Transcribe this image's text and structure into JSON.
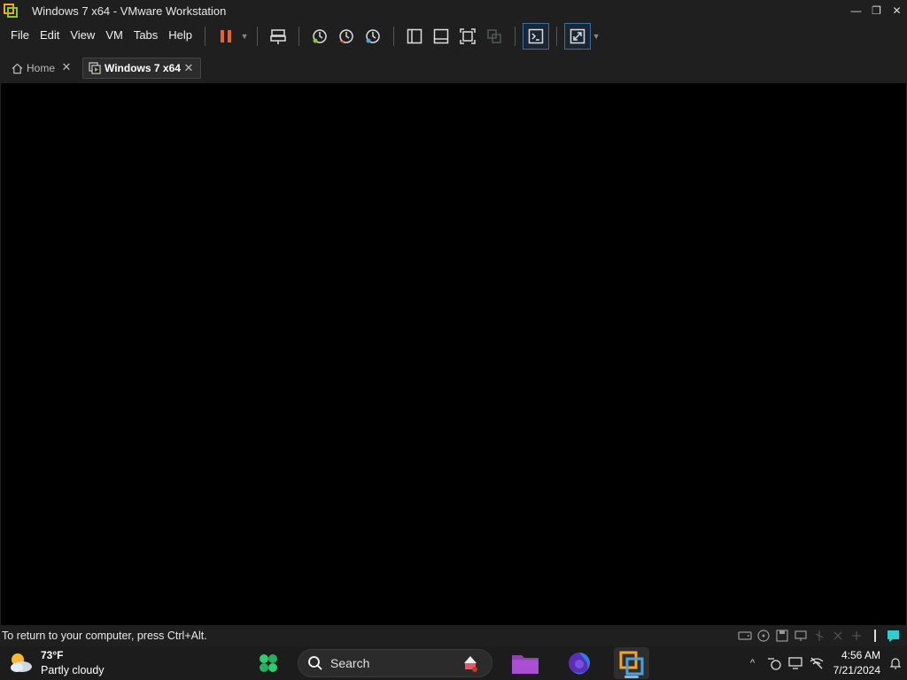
{
  "window": {
    "title": "Windows 7 x64 - VMware Workstation",
    "icon": "vmware-icon",
    "controls": {
      "minimize": "—",
      "restore": "❐",
      "close": "✕"
    }
  },
  "menu": {
    "items": [
      "File",
      "Edit",
      "View",
      "VM",
      "Tabs",
      "Help"
    ]
  },
  "toolbar": {
    "icons": [
      "pause-icon",
      "send-ctrl-alt-del-icon",
      "snapshot-icon",
      "revert-snapshot-icon",
      "snapshot-manager-icon",
      "show-library-icon",
      "show-thumbnail-icon",
      "fit-guest-icon",
      "unity-icon",
      "console-view-icon",
      "fullscreen-icon"
    ],
    "accent": "#e8632c"
  },
  "tabs": [
    {
      "label": "Home",
      "icon": "home-icon",
      "close": "✕"
    },
    {
      "label": "Windows 7 x64",
      "icon": "vm-tab-icon",
      "close": "✕",
      "active": true
    }
  ],
  "status": {
    "message": "To return to your computer, press Ctrl+Alt.",
    "icons": [
      "hard-disk-icon",
      "cd-dvd-icon",
      "floppy-icon",
      "network-icon",
      "usb-icon",
      "sound-icon",
      "printer-icon",
      "display-icon",
      "message-icon"
    ]
  },
  "taskbar": {
    "weather": {
      "temp": "73°F",
      "condition": "Partly cloudy",
      "icon": "partly-cloudy-icon"
    },
    "search": {
      "label": "Search"
    },
    "apps": [
      "widgets-icon",
      "file-explorer-icon",
      "firefox-icon",
      "vmware-icon"
    ],
    "tray": {
      "chevron": "^"
    },
    "clock": {
      "time": "4:56 AM",
      "date": "7/21/2024"
    }
  }
}
